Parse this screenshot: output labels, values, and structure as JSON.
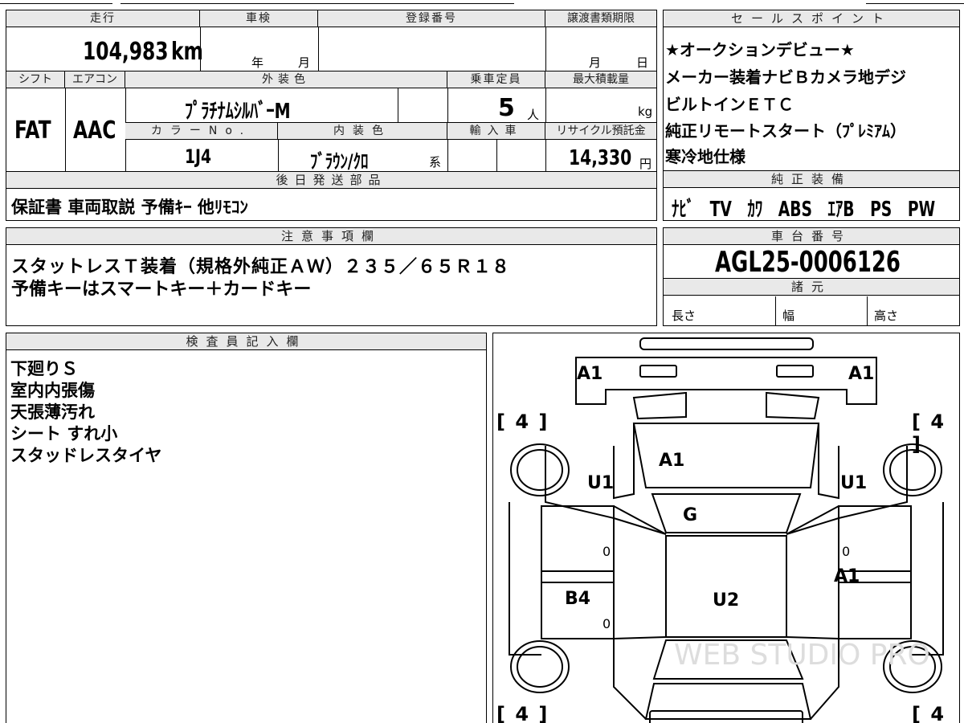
{
  "spec_sheet": {
    "headers": {
      "mileage": "走行",
      "inspection": "車検",
      "registration_no": "登録番号",
      "transfer_deadline": "譲渡書類期限",
      "shift": "シフト",
      "aircon": "エアコン",
      "exterior_color": "外装色",
      "capacity": "乗車定員",
      "max_load": "最大積載量",
      "color_no": "カラーNo.",
      "interior_color": "内装色",
      "import": "輸入車",
      "recycle_fee": "リサイクル預託金",
      "after_parts": "後日発送部品"
    },
    "mileage_value": "104,983",
    "mileage_unit": "km",
    "inspection_year": "年",
    "inspection_month": "月",
    "transfer_month": "月",
    "transfer_day": "日",
    "shift_value": "FAT",
    "aircon_value": "AAC",
    "exterior_color_value": "ﾌﾟﾗﾁﾅﾑｼﾙﾊﾞｰM",
    "capacity_value": "5",
    "capacity_unit": "人",
    "max_load_unit": "kg",
    "color_no_value": "1J4",
    "interior_color_value": "ﾌﾞﾗｳﾝ/ｸﾛ",
    "interior_suffix": "系",
    "recycle_value": "14,330",
    "recycle_unit": "円",
    "after_parts_value": "保証書 車両取説 予備ｷｰ 他ﾘﾓｺﾝ"
  },
  "sales_points": {
    "title": "セールスポイント",
    "lines": [
      "★オークションデビュー★",
      "メーカー装着ナビＢカメラ地デジ",
      "ビルトインＥＴＣ",
      "純正リモートスタート（ﾌﾟﾚﾐｱﾑ）",
      "寒冷地仕様"
    ]
  },
  "equipment": {
    "title": "純正装備",
    "items": [
      "ﾅﾋﾞ",
      "TV",
      "ｶﾜ",
      "ABS",
      "ｴｱB",
      "PS",
      "PW"
    ]
  },
  "notes": {
    "title": "注意事項欄",
    "lines": [
      "スタットレスＴ装着（規格外純正ＡＷ）２３５／６５Ｒ１８",
      "予備キーはスマートキー＋カードキー"
    ]
  },
  "chassis": {
    "title": "車台番号",
    "value": "AGL25-0006126",
    "specs_title": "諸元",
    "length_label": "長さ",
    "width_label": "幅",
    "height_label": "高さ"
  },
  "inspector": {
    "title": "検査員記入欄",
    "lines": [
      "下廻りＳ",
      "室内内張傷",
      "天張薄汚れ",
      "シート すれ小",
      "スタッドレスタイヤ"
    ]
  },
  "diagram": {
    "marks": {
      "front_left": "A1",
      "front_right": "A1",
      "hood": "A1",
      "fender_left": "U1",
      "fender_right": "U1",
      "windshield": "G",
      "rear_door_left": "B4",
      "roof": "U2",
      "rear_door_right": "A1",
      "door_left_front": "0",
      "door_left_rear": "0",
      "door_right_front": "0",
      "tire_fl": "4",
      "tire_fr": "4",
      "tire_rl": "4",
      "tire_rr": "4"
    },
    "watermark": "WEB STUDIO PRO"
  }
}
